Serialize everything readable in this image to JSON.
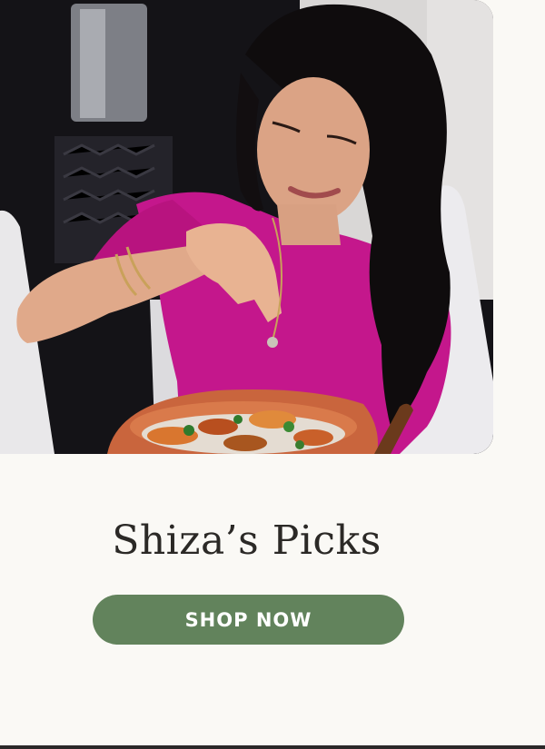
{
  "hero": {
    "image_alt": "Woman in pink top sprinkling garnish over a bowl of food"
  },
  "promo": {
    "title": "Shiza’s Picks",
    "cta_label": "SHOP NOW"
  },
  "colors": {
    "background": "#faf9f5",
    "button": "#62835c",
    "button_text": "#ffffff",
    "title_text": "#2b2926"
  }
}
